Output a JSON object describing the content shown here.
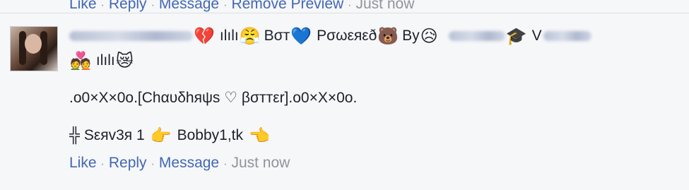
{
  "top_actions": {
    "like": "Like",
    "reply": "Reply",
    "message": "Message",
    "remove_preview": "Remove Preview",
    "time": "Just now"
  },
  "comment": {
    "line1": {
      "emoji_broken_heart": "💔",
      "bars": "ılılı",
      "emoji_persevere": "😤",
      "word_bot": "Bσт",
      "emoji_blue_heart": "💙",
      "word_powered": "Pσωεяεð",
      "emoji_bear": "🐻",
      "word_by": "Bу",
      "emoji_sad": "😥",
      "emoji_cap": "🎓",
      "letter_v": "V"
    },
    "line2": {
      "emoji_couple": "💑",
      "bars": "ılılı",
      "emoji_cat": "😿"
    },
    "body": ".o0×X×0o.[Chαυδhяψs ♡ βσттεr].o0×X×0o.",
    "line4": {
      "symbol": "╬",
      "server": "Sεяv3я 1",
      "emoji_point_right": "👉",
      "bot_name": "Bobby1,tk",
      "emoji_point_left": "👈"
    },
    "actions": {
      "like": "Like",
      "reply": "Reply",
      "message": "Message",
      "time": "Just now"
    }
  },
  "colors": {
    "link": "#4267b2",
    "muted": "#90949c",
    "background": "#f6f7f9"
  }
}
